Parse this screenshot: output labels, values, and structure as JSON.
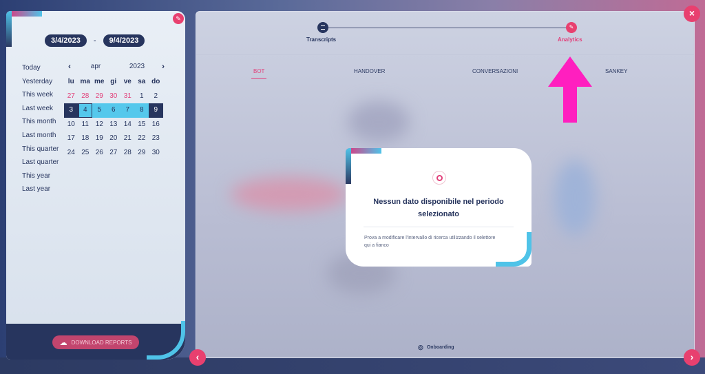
{
  "date_range": {
    "start": "3/4/2023",
    "separator": "-",
    "end": "9/4/2023"
  },
  "shortcuts": [
    "Today",
    "Yesterday",
    "This week",
    "Last week",
    "This month",
    "Last month",
    "This quarter",
    "Last quarter",
    "This year",
    "Last year"
  ],
  "calendar": {
    "month": "apr",
    "year": "2023",
    "prev_icon": "‹",
    "next_icon": "›",
    "weekdays": [
      "lu",
      "ma",
      "me",
      "gi",
      "ve",
      "sa",
      "do"
    ],
    "weeks": [
      [
        "27",
        "28",
        "29",
        "30",
        "31",
        "1",
        "2"
      ],
      [
        "3",
        "4",
        "5",
        "6",
        "7",
        "8",
        "9"
      ],
      [
        "10",
        "11",
        "12",
        "13",
        "14",
        "15",
        "16"
      ],
      [
        "17",
        "18",
        "19",
        "20",
        "21",
        "22",
        "23"
      ],
      [
        "24",
        "25",
        "26",
        "27",
        "28",
        "29",
        "30"
      ]
    ]
  },
  "download_label": "DOWNLOAD REPORTS",
  "stepper": {
    "step1": "Transcripts",
    "step2": "Analytics"
  },
  "tabs": [
    "BOT",
    "HANDOVER",
    "CONVERSAZIONI",
    "SANKEY"
  ],
  "modal": {
    "title": "Nessun dato disponibile nel periodo selezionato",
    "text": "Prova a modificare l'intervallo di ricerca utilizzando il selettore qui a fianco"
  },
  "footer_link": "Onboarding",
  "colors": {
    "accent": "#e8406f",
    "navy": "#27355e",
    "cyan": "#4fc3e8"
  }
}
